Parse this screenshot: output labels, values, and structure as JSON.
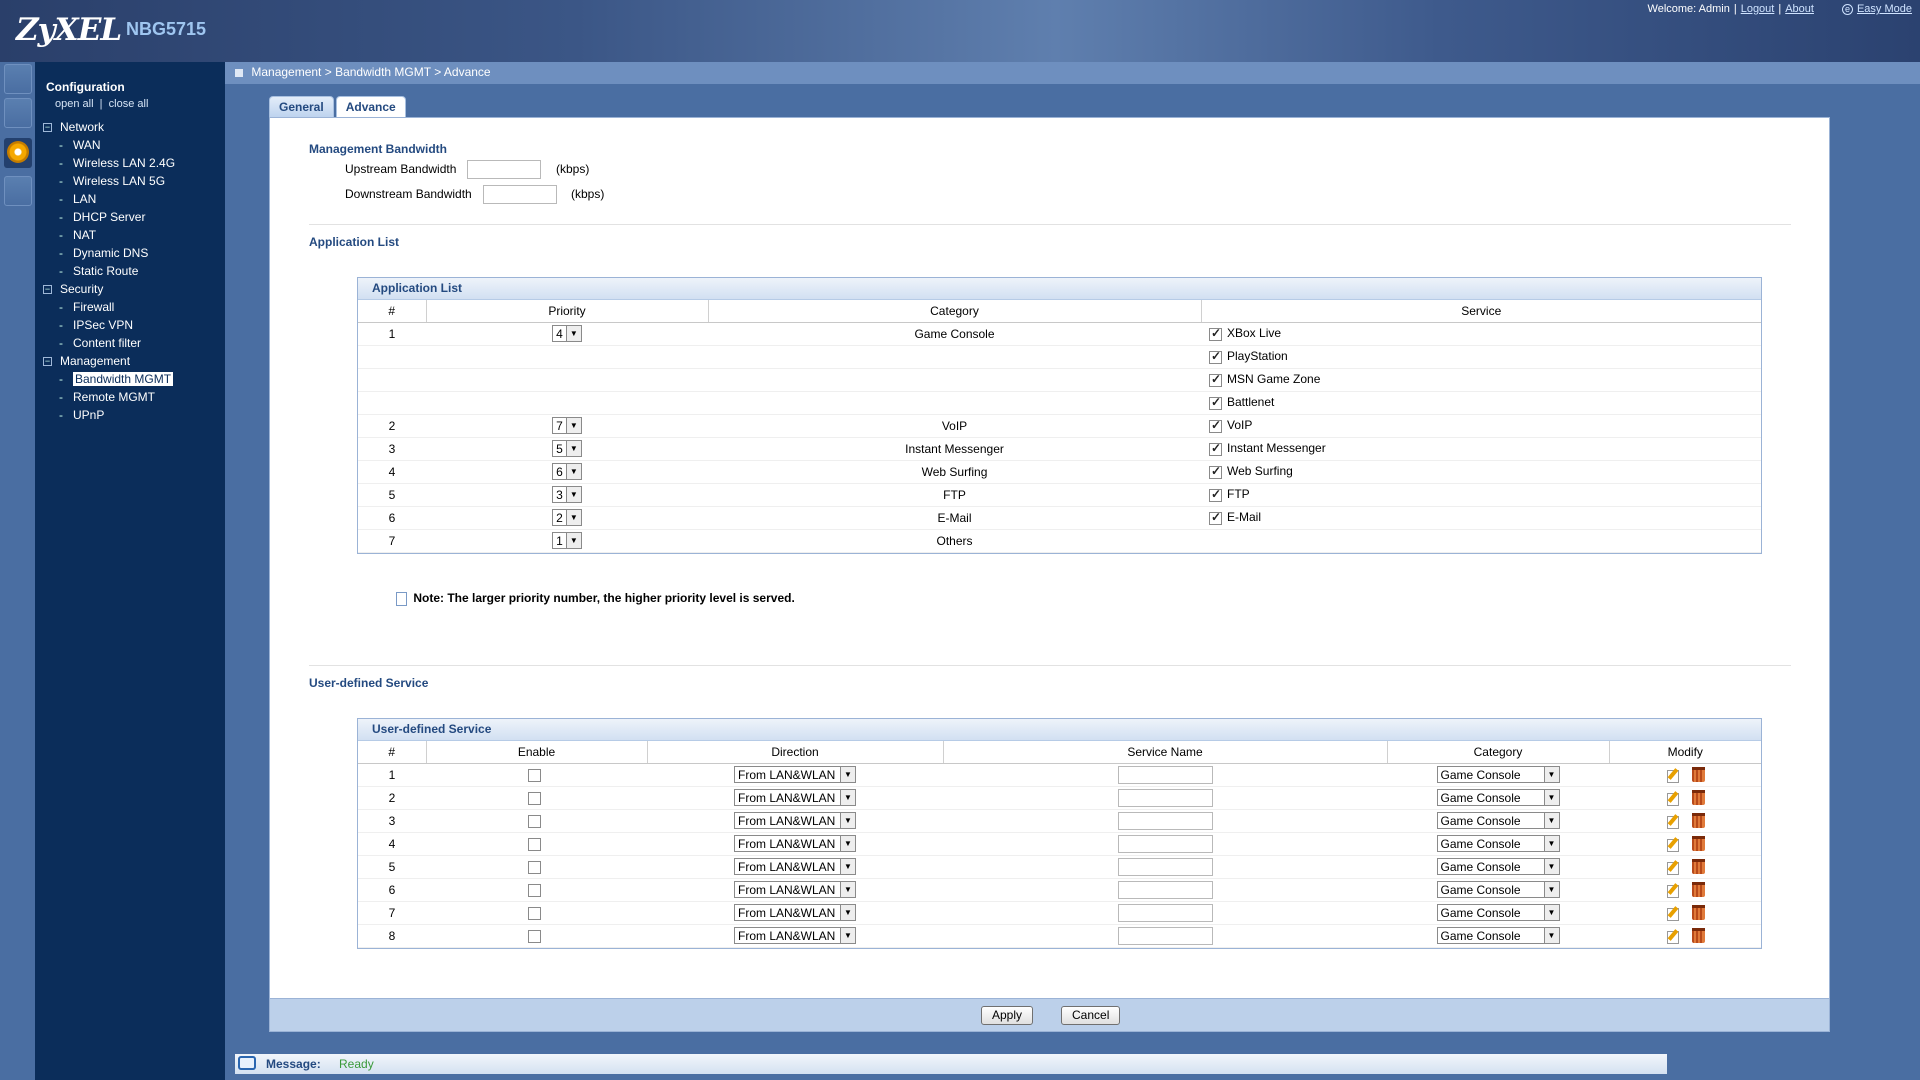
{
  "header": {
    "brand": "ZyXEL",
    "model": "NBG5715",
    "welcome": "Welcome: Admin",
    "logout": "Logout",
    "about": "About",
    "easy_mode": "Easy Mode"
  },
  "sidebar": {
    "title": "Configuration",
    "open_all": "open all",
    "close_all": "close all",
    "groups": [
      {
        "label": "Network",
        "items": [
          "WAN",
          "Wireless LAN 2.4G",
          "Wireless LAN 5G",
          "LAN",
          "DHCP Server",
          "NAT",
          "Dynamic DNS",
          "Static Route"
        ]
      },
      {
        "label": "Security",
        "items": [
          "Firewall",
          "IPSec VPN",
          "Content filter"
        ]
      },
      {
        "label": "Management",
        "items": [
          "Bandwidth MGMT",
          "Remote MGMT",
          "UPnP"
        ]
      }
    ],
    "selected": "Bandwidth MGMT"
  },
  "breadcrumb": "Management > Bandwidth MGMT > Advance",
  "tabs": [
    "General",
    "Advance"
  ],
  "active_tab": "Advance",
  "mgmt_bandwidth": {
    "title": "Management Bandwidth",
    "upstream_label": "Upstream Bandwidth",
    "upstream_value": "",
    "downstream_label": "Downstream Bandwidth",
    "downstream_value": "",
    "unit": "(kbps)"
  },
  "app_list": {
    "section_title": "Application List",
    "box_title": "Application List",
    "columns": [
      "#",
      "Priority",
      "Category",
      "Service"
    ],
    "rows": [
      {
        "num": "1",
        "priority": "4",
        "category": "Game Console",
        "service": "XBox Live",
        "checked": true
      },
      {
        "num": "",
        "priority": "",
        "category": "",
        "service": "PlayStation",
        "checked": true
      },
      {
        "num": "",
        "priority": "",
        "category": "",
        "service": "MSN Game Zone",
        "checked": true
      },
      {
        "num": "",
        "priority": "",
        "category": "",
        "service": "Battlenet",
        "checked": true
      },
      {
        "num": "2",
        "priority": "7",
        "category": "VoIP",
        "service": "VoIP",
        "checked": true
      },
      {
        "num": "3",
        "priority": "5",
        "category": "Instant Messenger",
        "service": "Instant Messenger",
        "checked": true
      },
      {
        "num": "4",
        "priority": "6",
        "category": "Web Surfing",
        "service": "Web Surfing",
        "checked": true
      },
      {
        "num": "5",
        "priority": "3",
        "category": "FTP",
        "service": "FTP",
        "checked": true
      },
      {
        "num": "6",
        "priority": "2",
        "category": "E-Mail",
        "service": "E-Mail",
        "checked": true
      },
      {
        "num": "7",
        "priority": "1",
        "category": "Others",
        "service": "",
        "checked": false
      }
    ],
    "note": "Note: The larger priority number, the higher priority level is served."
  },
  "user_service": {
    "section_title": "User-defined Service",
    "box_title": "User-defined Service",
    "columns": [
      "#",
      "Enable",
      "Direction",
      "Service Name",
      "Category",
      "Modify"
    ],
    "rows": [
      {
        "num": "1",
        "enabled": false,
        "direction": "From LAN&WLAN",
        "service_name": "",
        "category": "Game Console"
      },
      {
        "num": "2",
        "enabled": false,
        "direction": "From LAN&WLAN",
        "service_name": "",
        "category": "Game Console"
      },
      {
        "num": "3",
        "enabled": false,
        "direction": "From LAN&WLAN",
        "service_name": "",
        "category": "Game Console"
      },
      {
        "num": "4",
        "enabled": false,
        "direction": "From LAN&WLAN",
        "service_name": "",
        "category": "Game Console"
      },
      {
        "num": "5",
        "enabled": false,
        "direction": "From LAN&WLAN",
        "service_name": "",
        "category": "Game Console"
      },
      {
        "num": "6",
        "enabled": false,
        "direction": "From LAN&WLAN",
        "service_name": "",
        "category": "Game Console"
      },
      {
        "num": "7",
        "enabled": false,
        "direction": "From LAN&WLAN",
        "service_name": "",
        "category": "Game Console"
      },
      {
        "num": "8",
        "enabled": false,
        "direction": "From LAN&WLAN",
        "service_name": "",
        "category": "Game Console"
      }
    ]
  },
  "buttons": {
    "apply": "Apply",
    "cancel": "Cancel"
  },
  "status": {
    "label": "Message:",
    "value": "Ready"
  }
}
